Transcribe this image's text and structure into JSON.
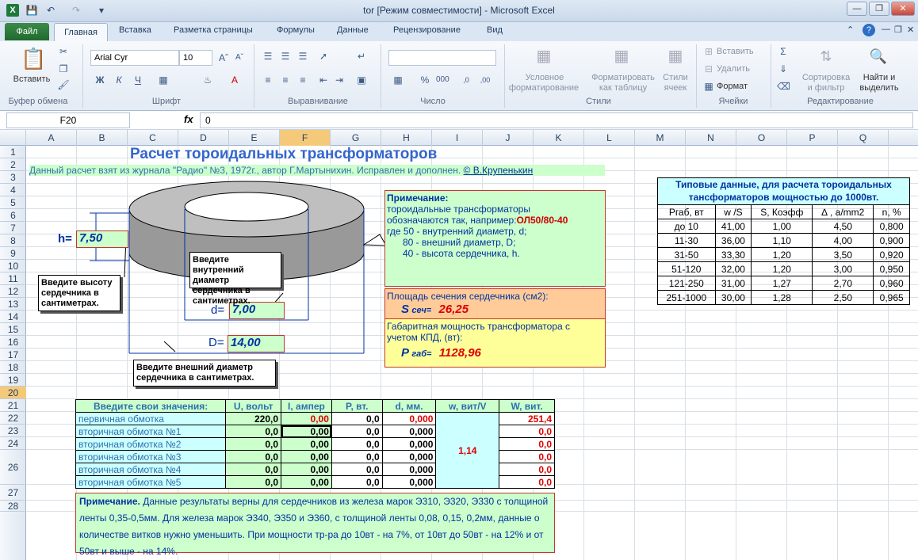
{
  "window": {
    "title": "tor  [Режим совместимости]  -  Microsoft Excel"
  },
  "tabs": {
    "file": "Файл",
    "items": [
      "Главная",
      "Вставка",
      "Разметка страницы",
      "Формулы",
      "Данные",
      "Рецензирование",
      "Вид"
    ]
  },
  "ribbon": {
    "paste": "Вставить",
    "clipboard": "Буфер обмена",
    "font_name": "Arial Cyr",
    "font_size": "10",
    "font_group": "Шрифт",
    "align_group": "Выравнивание",
    "number_group": "Число",
    "cond_format_1": "Условное",
    "cond_format_2": "форматирование",
    "format_table_1": "Форматировать",
    "format_table_2": "как таблицу",
    "cell_styles_1": "Стили",
    "cell_styles_2": "ячеек",
    "styles_group": "Стили",
    "insert": "Вставить",
    "delete": "Удалить",
    "format": "Формат",
    "cells_group": "Ячейки",
    "sort_1": "Сортировка",
    "sort_2": "и фильтр",
    "find_1": "Найти и",
    "find_2": "выделить",
    "edit_group": "Редактирование"
  },
  "formula_bar": {
    "name_box": "F20",
    "fx": "fx",
    "value": "0"
  },
  "columns": [
    "A",
    "B",
    "C",
    "D",
    "E",
    "F",
    "G",
    "H",
    "I",
    "J",
    "K",
    "L",
    "M",
    "N",
    "O",
    "P",
    "Q"
  ],
  "rows": [
    "1",
    "2",
    "3",
    "4",
    "5",
    "6",
    "7",
    "8",
    "9",
    "10",
    "11",
    "12",
    "13",
    "14",
    "15",
    "16",
    "17",
    "18",
    "19",
    "20",
    "21",
    "22",
    "23",
    "24",
    "26",
    "27",
    "28"
  ],
  "sheet": {
    "title": "Расчет тороидальных трансформаторов",
    "source": "Данный расчет взят из журнала \"Радио\" №3, 1972г., автор Г.Мартынихин. Исправлен и дополнен.",
    "author": "© В.Крупенькин",
    "h_label": "h=",
    "h_value": "7,50",
    "d_label": "d=",
    "d_value": "7,00",
    "D_label": "D=",
    "D_value": "14,00",
    "callout_height": "Введите высоту сердечника в сантиметрах.",
    "callout_inner": "Введите внутренний диаметр сердечника в сантиметрах.",
    "callout_outer": "Введите внешний диаметр сердечника в сантиметрах.",
    "note_title": "Примечание:",
    "note_line1": "тороидальные   трансформаторы",
    "note_line2": "обозначаются  так,  например:",
    "note_example": "ОЛ50/80-40",
    "note_line3": "где 50 - внутренний  диаметр,  d;",
    "note_line4": "80 - внешний диаметр,  D;",
    "note_line5": "40 - высота сердечника,  h.",
    "area_label": "Площадь сечения сердечника (см2):",
    "area_symbol": "S",
    "area_sub": "сеч=",
    "area_value": "26,25",
    "power_label_1": "Габаритная мощность трансформатора с",
    "power_label_2": "учетом КПД, (вт):",
    "power_symbol": "P",
    "power_sub": "габ=",
    "power_value": "1128,96"
  },
  "typical": {
    "title_1": "Типовые данные, для расчета тороидальных",
    "title_2": "тансформаторов мощностью до 1000вт.",
    "headers": [
      "Pгаб, вт",
      "w /S",
      "S, Коэфф",
      "∆ , a/mm2",
      "n, %"
    ],
    "rows": [
      [
        "до 10",
        "41,00",
        "1,00",
        "4,50",
        "0,800"
      ],
      [
        "11-30",
        "36,00",
        "1,10",
        "4,00",
        "0,900"
      ],
      [
        "31-50",
        "33,30",
        "1,20",
        "3,50",
        "0,920"
      ],
      [
        "51-120",
        "32,00",
        "1,20",
        "3,00",
        "0,950"
      ],
      [
        "121-250",
        "31,00",
        "1,27",
        "2,70",
        "0,960"
      ],
      [
        "251-1000",
        "30,00",
        "1,28",
        "2,50",
        "0,965"
      ]
    ]
  },
  "calc": {
    "headers": [
      "Введите свои значения:",
      "U, вольт",
      "I, ампер",
      "P, вт.",
      "d, мм.",
      "w, вит/V",
      "W, вит."
    ],
    "rows": [
      [
        "первичная обмотка",
        "220,0",
        "0,00",
        "0,0",
        "0,000",
        "251,4"
      ],
      [
        "вторичная обмотка №1",
        "0,0",
        "0,00",
        "0,0",
        "0,000",
        "0,0"
      ],
      [
        "вторичная обмотка №2",
        "0,0",
        "0,00",
        "0,0",
        "0,000",
        "0,0"
      ],
      [
        "вторичная обмотка №3",
        "0,0",
        "0,00",
        "0,0",
        "0,000",
        "0,0"
      ],
      [
        "вторичная обмотка №4",
        "0,0",
        "0,00",
        "0,0",
        "0,000",
        "0,0"
      ],
      [
        "вторичная обмотка №5",
        "0,0",
        "0,00",
        "0,0",
        "0,000",
        "0,0"
      ]
    ],
    "w_per_v": "1,14"
  },
  "bottom_note": {
    "bold": "Примечание.",
    "text": " Данные результаты верны для сердечников из железа марок Э310, Э320, Э330 с толщиной ленты 0,35-0,5мм. Для железа марок Э340, Э350 и Э360, с толщиной ленты 0,08, 0,15, 0,2мм, данные о количестве витков нужно уменьшить. При мощности тр-ра до 10вт - на 7%, от 10вт до 50вт - на 12% и от 50вт и выше - на 14%."
  }
}
